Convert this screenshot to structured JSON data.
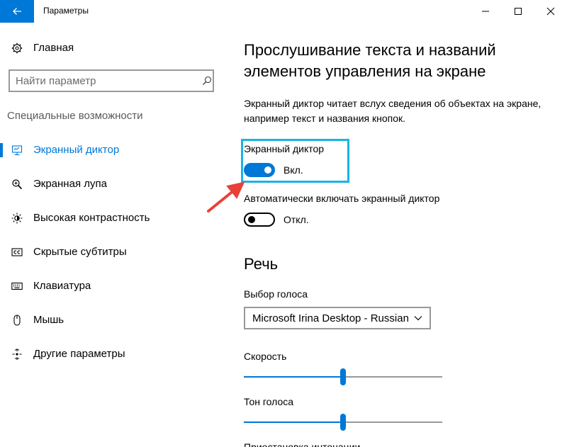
{
  "window": {
    "title": "Параметры",
    "back_icon": "back-arrow-icon",
    "controls": [
      "minimize-icon",
      "maximize-icon",
      "close-icon"
    ]
  },
  "sidebar": {
    "home_label": "Главная",
    "search": {
      "placeholder": "Найти параметр",
      "value": ""
    },
    "section_heading": "Специальные возможности",
    "items": [
      {
        "label": "Экранный диктор",
        "icon": "narrator-icon",
        "active": true
      },
      {
        "label": "Экранная лупа",
        "icon": "magnifier-icon",
        "active": false
      },
      {
        "label": "Высокая контрастность",
        "icon": "contrast-icon",
        "active": false
      },
      {
        "label": "Скрытые субтитры",
        "icon": "closed-captions-icon",
        "active": false
      },
      {
        "label": "Клавиатура",
        "icon": "keyboard-icon",
        "active": false
      },
      {
        "label": "Мышь",
        "icon": "mouse-icon",
        "active": false
      },
      {
        "label": "Другие параметры",
        "icon": "other-options-icon",
        "active": false
      }
    ]
  },
  "main": {
    "title": "Прослушивание текста и названий элементов управления на экране",
    "description": "Экранный диктор читает вслух сведения об объектах на экране, например текст и названия кнопок.",
    "narrator": {
      "label": "Экранный диктор",
      "state_text": "Вкл.",
      "on": true
    },
    "auto_start": {
      "label": "Автоматически включать экранный диктор",
      "state_text": "Откл.",
      "on": false
    },
    "speech": {
      "heading": "Речь",
      "voice_label": "Выбор голоса",
      "voice_value": "Microsoft Irina Desktop - Russian",
      "speed_label": "Скорость",
      "speed_level": 0.5,
      "pitch_label": "Тон голоса",
      "pitch_level": 0.5,
      "next_label": "Приостановка интонации"
    }
  },
  "colors": {
    "accent": "#0078d7",
    "highlight_frame": "#1ab2e8",
    "annotation_arrow": "#e8413a"
  }
}
